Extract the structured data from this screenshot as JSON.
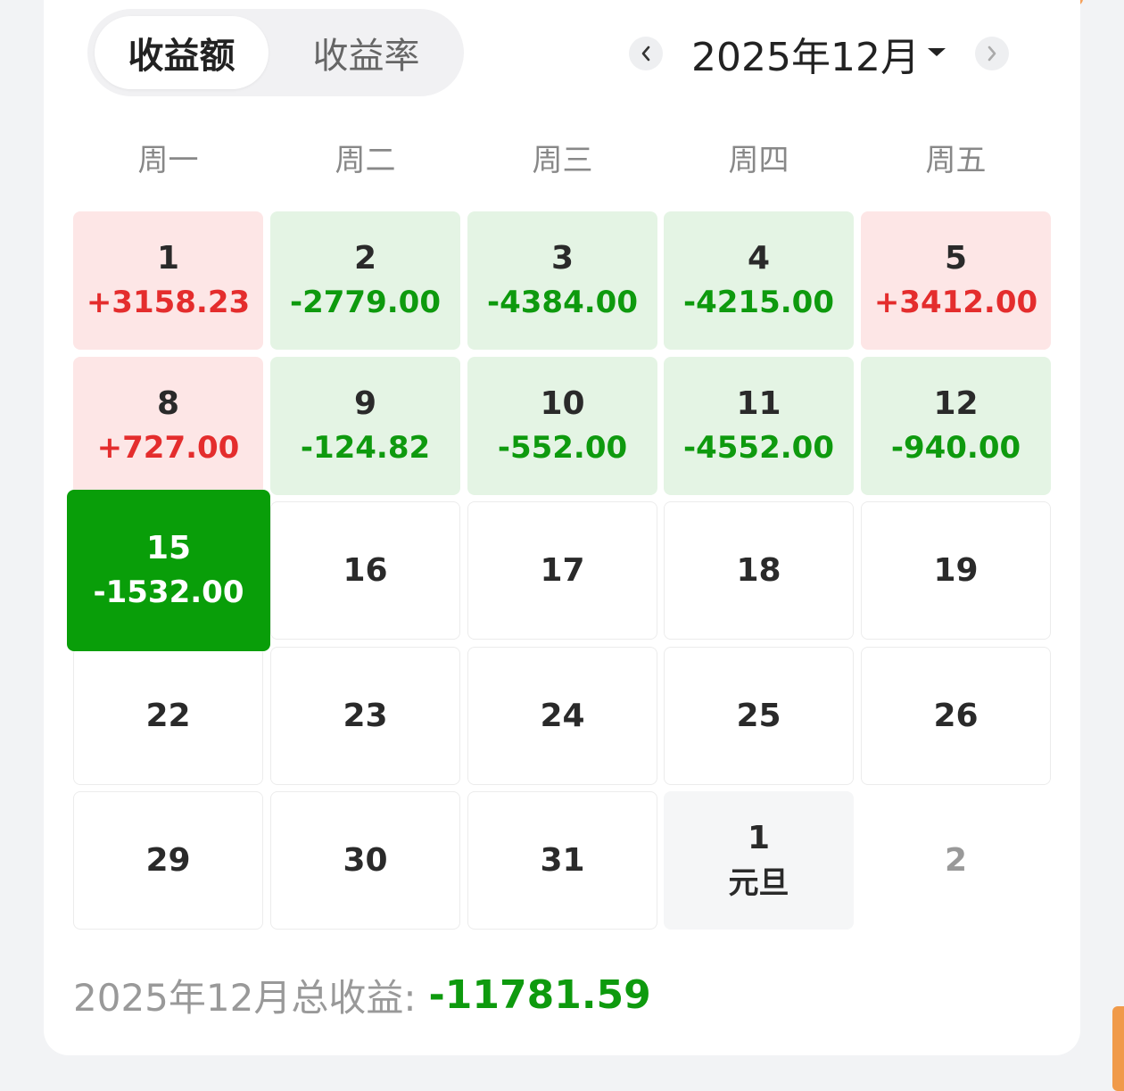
{
  "tabs": {
    "active": "收益额",
    "inactive": "收益率"
  },
  "month_nav": {
    "prev": "‹",
    "label": "2025年12月",
    "next": "›"
  },
  "weekdays": [
    "周一",
    "周二",
    "周三",
    "周四",
    "周五"
  ],
  "calendar": {
    "rows": [
      [
        {
          "day": "1",
          "amount": "+3158.23",
          "state": "gain"
        },
        {
          "day": "2",
          "amount": "-2779.00",
          "state": "loss"
        },
        {
          "day": "3",
          "amount": "-4384.00",
          "state": "loss"
        },
        {
          "day": "4",
          "amount": "-4215.00",
          "state": "loss"
        },
        {
          "day": "5",
          "amount": "+3412.00",
          "state": "gain"
        }
      ],
      [
        {
          "day": "8",
          "amount": "+727.00",
          "state": "gain"
        },
        {
          "day": "9",
          "amount": "-124.82",
          "state": "loss"
        },
        {
          "day": "10",
          "amount": "-552.00",
          "state": "loss"
        },
        {
          "day": "11",
          "amount": "-4552.00",
          "state": "loss"
        },
        {
          "day": "12",
          "amount": "-940.00",
          "state": "loss"
        }
      ],
      [
        {
          "day": "15",
          "amount": "-1532.00",
          "state": "selected"
        },
        {
          "day": "16",
          "state": "empty"
        },
        {
          "day": "17",
          "state": "empty"
        },
        {
          "day": "18",
          "state": "empty"
        },
        {
          "day": "19",
          "state": "empty"
        }
      ],
      [
        {
          "day": "22",
          "state": "empty"
        },
        {
          "day": "23",
          "state": "empty"
        },
        {
          "day": "24",
          "state": "empty"
        },
        {
          "day": "25",
          "state": "empty"
        },
        {
          "day": "26",
          "state": "empty"
        }
      ],
      [
        {
          "day": "29",
          "state": "empty"
        },
        {
          "day": "30",
          "state": "empty"
        },
        {
          "day": "31",
          "state": "empty"
        },
        {
          "day": "1",
          "holiday": "元旦",
          "state": "other"
        },
        {
          "day": "2",
          "state": "future"
        }
      ]
    ]
  },
  "summary": {
    "label": "2025年12月总收益:",
    "value": "-11781.59"
  },
  "colors": {
    "gain_bg": "#fde6e6",
    "loss_bg": "#e4f4e4",
    "gain_text": "#e42d2d",
    "loss_text": "#0e9a0e",
    "selected_bg": "#099e09"
  }
}
